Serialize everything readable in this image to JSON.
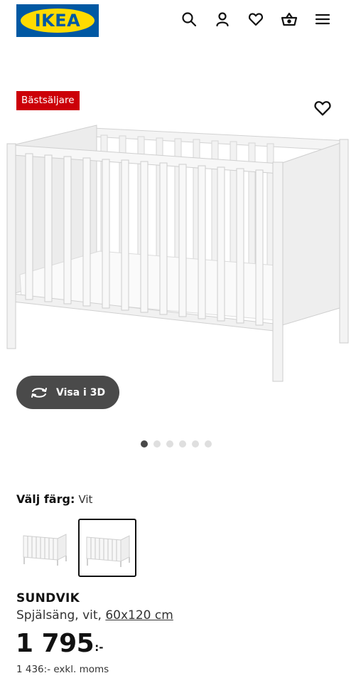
{
  "header": {
    "logo_text": "IKEA",
    "icons": [
      "search-icon",
      "user-icon",
      "heart-icon",
      "basket-icon",
      "menu-icon"
    ]
  },
  "gallery": {
    "badge": "Bästsäljare",
    "view_3d_label": "Visa i 3D",
    "slide_count": 6,
    "active_slide": 1
  },
  "color_select": {
    "label": "Välj färg:",
    "value": "Vit",
    "options_count": 2,
    "selected_index": 1
  },
  "product": {
    "name": "SUNDVIK",
    "description": "Spjälsäng, vit,",
    "size": "60x120 cm",
    "price": "1 795",
    "price_suffix": ":-",
    "price_ex_vat": "1 436:- exkl. moms"
  },
  "colors": {
    "brand_blue": "#0058a3",
    "brand_yellow": "#ffdb00",
    "badge_red": "#cc0008",
    "button_dark": "#4a4a4a"
  }
}
